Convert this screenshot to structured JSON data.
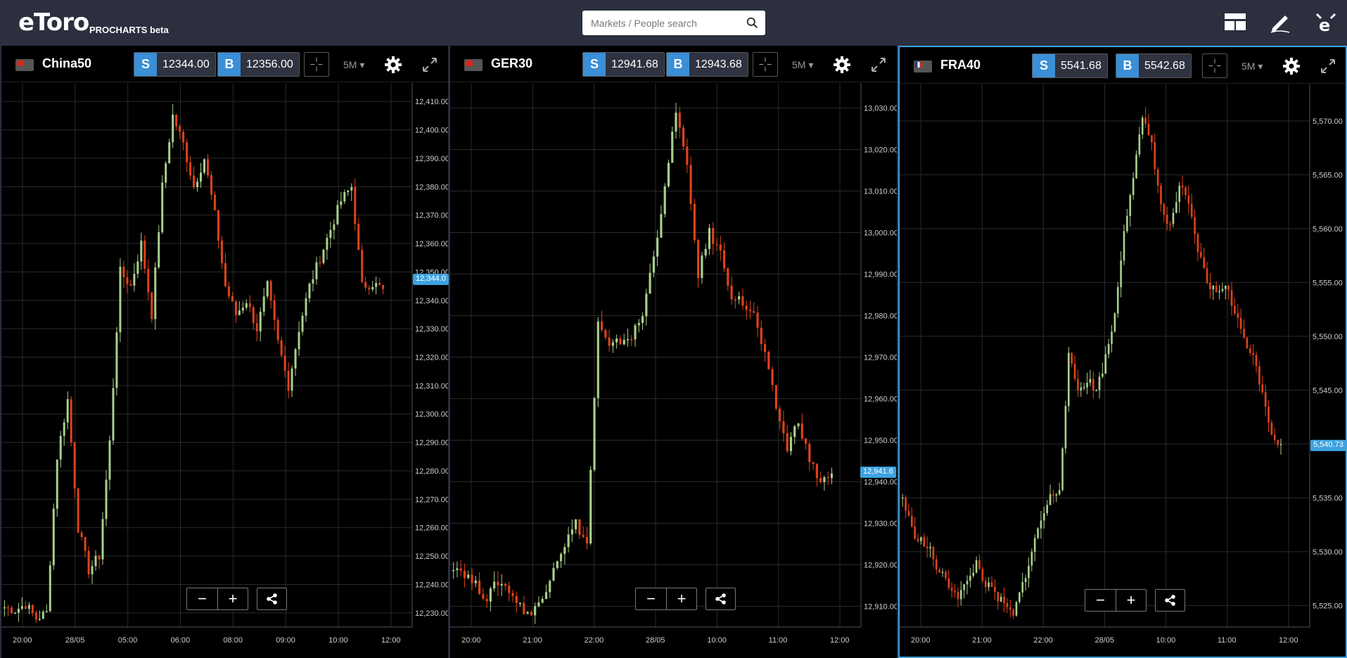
{
  "app": {
    "logo_text": "eToro",
    "logo_sub": "PROCHARTS beta",
    "search_placeholder": "Markets / People search",
    "icons": [
      "layout-icon",
      "pencil-icon",
      "etoro-avatar-icon"
    ]
  },
  "colors": {
    "accent": "#3da2e0",
    "bull": "#a8d08d",
    "bear": "#e0421b",
    "background": "#000000",
    "topbar": "#2b2f3e"
  },
  "panels": [
    {
      "name": "China50",
      "sell_label": "S",
      "sell_value": "12344.00",
      "buy_label": "B",
      "buy_value": "12356.00",
      "timeframe": "5M",
      "current_price_tag": "12,344.0",
      "y_ticks": [
        "12,410.00",
        "12,400.00",
        "12,390.00",
        "12,380.00",
        "12,370.00",
        "12,360.00",
        "12,350.00",
        "12,340.00",
        "12,330.00",
        "12,320.00",
        "12,310.00",
        "12,300.00",
        "12,290.00",
        "12,280.00",
        "12,270.00",
        "12,260.00",
        "12,250.00",
        "12,240.00",
        "12,230.00"
      ],
      "x_ticks": [
        "20:00",
        "28/05",
        "05:00",
        "06:00",
        "08:00",
        "09:00",
        "10:00",
        "12:00"
      ]
    },
    {
      "name": "GER30",
      "sell_label": "S",
      "sell_value": "12941.68",
      "buy_label": "B",
      "buy_value": "12943.68",
      "timeframe": "5M",
      "current_price_tag": "12,941.6",
      "y_ticks": [
        "13,030.00",
        "13,020.00",
        "13,010.00",
        "13,000.00",
        "12,990.00",
        "12,980.00",
        "12,970.00",
        "12,960.00",
        "12,950.00",
        "12,940.00",
        "12,930.00",
        "12,920.00",
        "12,910.00"
      ],
      "x_ticks": [
        "20:00",
        "21:00",
        "22:00",
        "28/05",
        "10:00",
        "11:00",
        "12:00"
      ]
    },
    {
      "name": "FRA40",
      "sell_label": "S",
      "sell_value": "5541.68",
      "buy_label": "B",
      "buy_value": "5542.68",
      "timeframe": "5M",
      "current_price_tag": "5,540.73",
      "y_ticks": [
        "5,570.00",
        "5,565.00",
        "5,560.00",
        "5,555.00",
        "5,550.00",
        "5,545.00",
        "5,540.00",
        "5,535.00",
        "5,530.00",
        "5,525.00"
      ],
      "x_ticks": [
        "20:00",
        "21:00",
        "22:00",
        "28/05",
        "10:00",
        "11:00",
        "12:00"
      ]
    }
  ],
  "chart_data": [
    {
      "type": "candlestick",
      "title": "China50",
      "ylim": [
        12225,
        12415
      ],
      "x": [
        "20:00",
        "28/05",
        "05:00",
        "06:00",
        "08:00",
        "09:00",
        "10:00",
        "12:00"
      ],
      "close_path": [
        12232,
        12231,
        12233,
        12228,
        12230,
        12285,
        12305,
        12260,
        12245,
        12250,
        12290,
        12350,
        12345,
        12360,
        12335,
        12380,
        12405,
        12395,
        12380,
        12390,
        12370,
        12345,
        12335,
        12340,
        12330,
        12345,
        12325,
        12310,
        12330,
        12345,
        12355,
        12365,
        12375,
        12380,
        12345,
        12346,
        12344
      ]
    },
    {
      "type": "candlestick",
      "title": "GER30",
      "ylim": [
        12905,
        13035
      ],
      "x": [
        "20:00",
        "21:00",
        "22:00",
        "28/05",
        "10:00",
        "11:00",
        "12:00"
      ],
      "close_path": [
        12920,
        12918,
        12915,
        12912,
        12916,
        12914,
        12910,
        12908,
        12912,
        12920,
        12925,
        12930,
        12925,
        12978,
        12972,
        12974,
        12975,
        12980,
        12995,
        13010,
        13030,
        13015,
        12990,
        13000,
        12995,
        12985,
        12983,
        12980,
        12970,
        12958,
        12948,
        12955,
        12945,
        12940,
        12942
      ]
    },
    {
      "type": "candlestick",
      "title": "FRA40",
      "ylim": [
        5523,
        5573
      ],
      "x": [
        "20:00",
        "21:00",
        "22:00",
        "28/05",
        "10:00",
        "11:00",
        "12:00"
      ],
      "close_path": [
        5535,
        5532,
        5531,
        5530,
        5528,
        5527,
        5526,
        5527,
        5529,
        5527,
        5526,
        5525,
        5524,
        5527,
        5530,
        5533,
        5535,
        5536,
        5548,
        5545,
        5546,
        5545,
        5548,
        5552,
        5560,
        5565,
        5570,
        5568,
        5562,
        5560,
        5564,
        5562,
        5558,
        5555,
        5554,
        5555,
        5552,
        5550,
        5548,
        5545,
        5541,
        5540
      ]
    }
  ]
}
